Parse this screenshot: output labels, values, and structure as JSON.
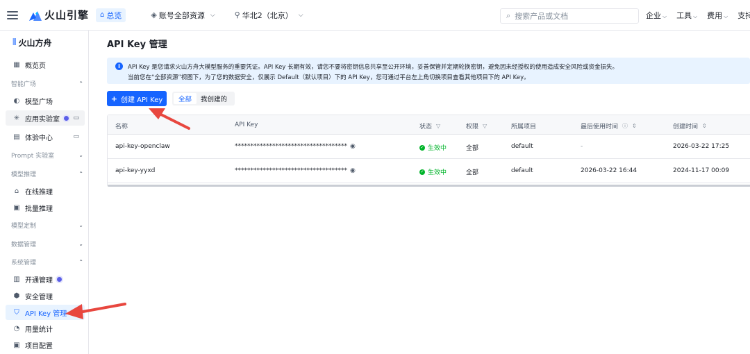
{
  "topbar": {
    "brand": "火山引擎",
    "home": "总览",
    "account_scope": "账号全部资源",
    "region": "华北2（北京）",
    "search_placeholder": "搜索产品或文档",
    "nav": [
      "企业",
      "工具",
      "费用",
      "支持"
    ]
  },
  "sidebar": {
    "brand": "火山方舟",
    "items": {
      "overview": "概览页",
      "group_plaza": "智能广场",
      "model_plaza": "模型广场",
      "lab": "应用实验室",
      "experience": "体验中心",
      "group_prompt": "Prompt 实验室",
      "group_inference": "模型推理",
      "online_inference": "在线推理",
      "batch_inference": "批量推理",
      "group_custom": "模型定制",
      "group_data": "数据管理",
      "group_system": "系统管理",
      "activation": "开通管理",
      "security": "安全管理",
      "api_key": "API Key 管理",
      "usage": "用量统计",
      "project": "项目配置"
    }
  },
  "main": {
    "title": "API Key 管理",
    "notice_line1": "API Key 是您请求火山方舟大模型服务的重要凭证。API Key 长期有效，请您不要将密钥信息共享至公开环境，妥善保管并定期轮换密钥，避免因未经授权的使用造成安全风险或资金损失。",
    "notice_line2": "当前您在“全部资源”视图下，为了您的数据安全，仅展示 Default（默认项目）下的 API Key，您可通过平台左上角切换项目查看其他项目下的 API Key。",
    "create_button": "创建 API Key",
    "filter_all": "全部",
    "filter_mine": "我创建的"
  },
  "table": {
    "headers": {
      "name": "名称",
      "key": "API Key",
      "status": "状态",
      "permission": "权限",
      "project": "所属项目",
      "last_used": "最后使用时间",
      "created": "创建时间"
    },
    "rows": [
      {
        "name": "api-key-openclaw",
        "key": "************************************",
        "status": "生效中",
        "permission": "全部",
        "project": "default",
        "last_used": "-",
        "created": "2026-03-22 17:25"
      },
      {
        "name": "api-key-yyxd",
        "key": "************************************",
        "status": "生效中",
        "permission": "全部",
        "project": "default",
        "last_used": "2026-03-22 16:44",
        "created": "2024-11-17 00:09"
      }
    ]
  },
  "colors": {
    "accent": "#1664ff",
    "success": "#00b42a",
    "arrow": "#e8473f",
    "notice_bg": "#e8f3ff"
  },
  "icons": [
    "hamburger-icon",
    "brand-logo-icon",
    "home-icon",
    "layers-icon",
    "location-icon",
    "search-icon",
    "info-icon",
    "eye-icon",
    "filter-icon",
    "sort-icon",
    "check-circle-icon"
  ]
}
